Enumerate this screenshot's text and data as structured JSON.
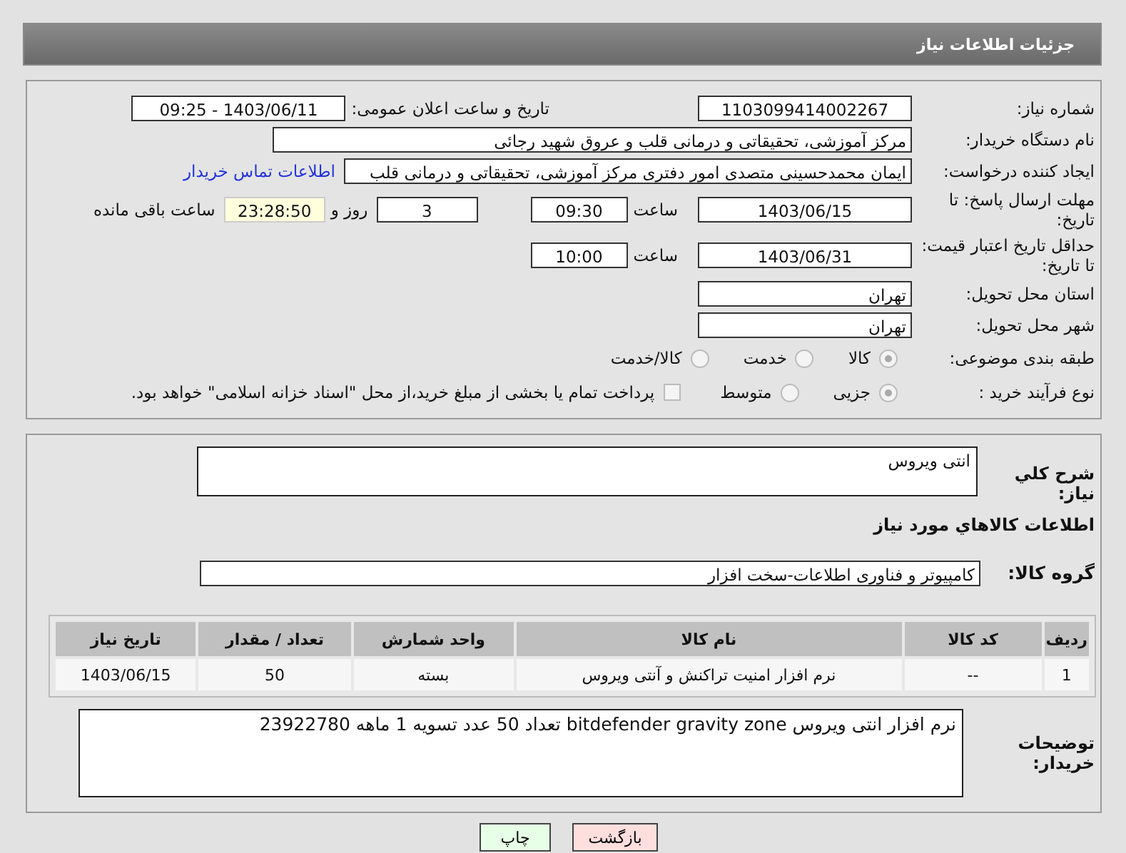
{
  "header": {
    "title": "جزئیات اطلاعات نیاز"
  },
  "need_number": {
    "label": "شماره نیاز:",
    "value": "1103099414002267"
  },
  "announce": {
    "label": "تاریخ و ساعت اعلان عمومی:",
    "value": "1403/06/11 - 09:25"
  },
  "buyer_org": {
    "label": "نام دستگاه خریدار:",
    "value": "مرکز آموزشی، تحقیقاتی و درمانی قلب و عروق شهید رجائی"
  },
  "requester": {
    "label": "ایجاد کننده درخواست:",
    "value": "ایمان محمدحسینی متصدی امور دفتری مرکز آموزشی، تحقیقاتی و درمانی قلب",
    "link": "اطلاعات تماس خریدار"
  },
  "response_deadline": {
    "label": "مهلت ارسال پاسخ: تا تاریخ:",
    "date": "1403/06/15",
    "time_label": "ساعت",
    "time": "09:30",
    "days": "3",
    "days_label": "روز و",
    "remaining": "23:28:50",
    "remaining_label": "ساعت باقی مانده"
  },
  "price_validity": {
    "label": "حداقل تاریخ اعتبار قیمت: تا تاریخ:",
    "date": "1403/06/31",
    "time_label": "ساعت",
    "time": "10:00"
  },
  "province": {
    "label": "استان محل تحویل:",
    "value": "تهران"
  },
  "city": {
    "label": "شهر محل تحویل:",
    "value": "تهران"
  },
  "category": {
    "label": "طبقه بندی موضوعی:",
    "options": [
      {
        "label": "کالا",
        "selected": true
      },
      {
        "label": "خدمت",
        "selected": false
      },
      {
        "label": "کالا/خدمت",
        "selected": false
      }
    ]
  },
  "process": {
    "label": "نوع فرآیند خرید :",
    "options": [
      {
        "label": "جزیی",
        "selected": true
      },
      {
        "label": "متوسط",
        "selected": false
      }
    ],
    "payment": {
      "checked": false,
      "text": "پرداخت تمام یا بخشی از مبلغ خرید،از محل \"اسناد خزانه اسلامی\" خواهد بود."
    }
  },
  "description": {
    "label": "شرح کلي نياز:",
    "value": "انتی ویروس"
  },
  "goods_heading": "اطلاعات کالاهاي مورد نياز",
  "group": {
    "label": "گروه کالا:",
    "value": "کامپیوتر و فناوری اطلاعات-سخت افزار"
  },
  "table": {
    "columns": [
      "ردیف",
      "کد کالا",
      "نام کالا",
      "واحد شمارش",
      "تعداد / مقدار",
      "تاریخ نیاز"
    ],
    "rows": [
      [
        "1",
        "--",
        "نرم افزار امنیت تراکنش و آنتی ویروس",
        "بسته",
        "50",
        "1403/06/15"
      ]
    ]
  },
  "buyer_notes": {
    "label": "توضیحات خریدار:",
    "value": "نرم افزار انتی ویروس bitdefender gravity zone تعداد 50 عدد تسویه 1 ماهه 23922780"
  },
  "buttons": [
    {
      "label": "بازگشت",
      "kind": "back"
    },
    {
      "label": "چاپ",
      "kind": "print"
    }
  ]
}
